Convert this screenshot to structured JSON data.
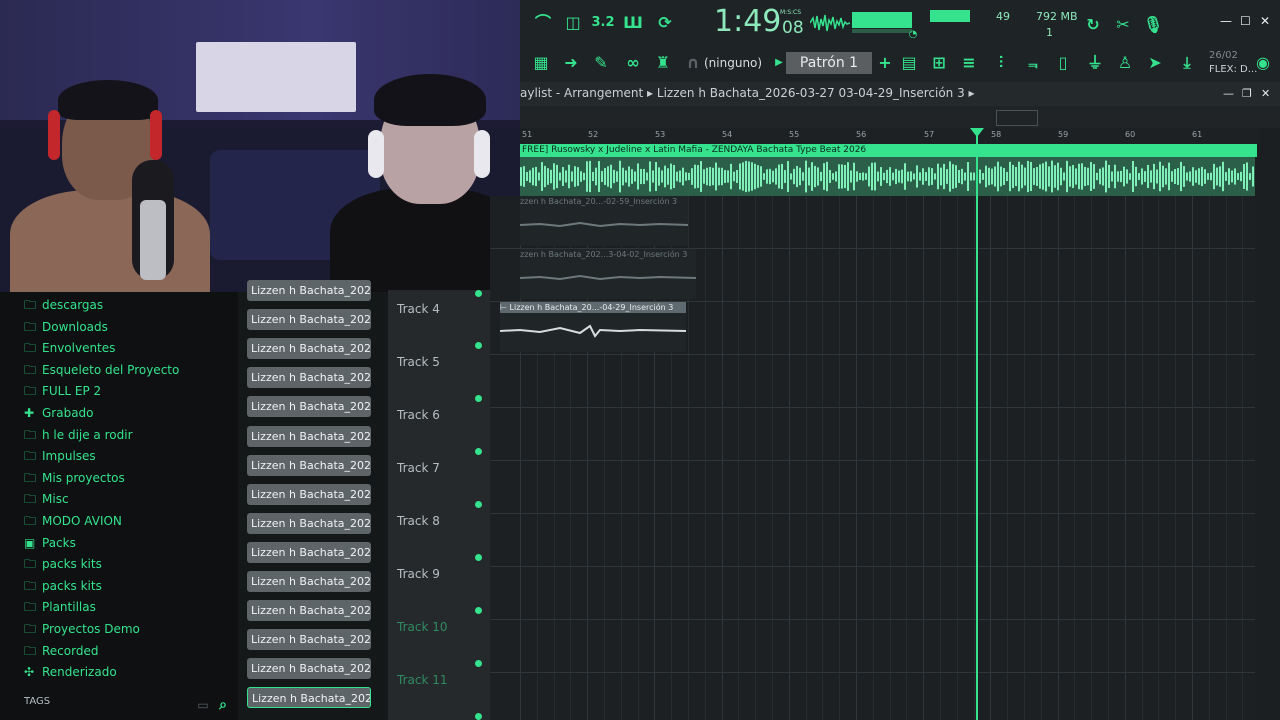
{
  "toolbar": {
    "clock": "1:49",
    "clock_sub": "08",
    "clock_label": "M:S:CS",
    "cpu": "49",
    "memory": "792 MB",
    "memory_sub": "1",
    "mode": "(ninguno)",
    "pattern": "Patrón 1",
    "date": "26/02",
    "flex": "FLEX: D...",
    "icons": [
      "pitch-icon",
      "metronome-icon",
      "step-icon",
      "wait-icon",
      "loop-icon",
      "tempo-knob-icon",
      "piano-icon",
      "arrow-right-icon",
      "brush-icon",
      "link-icon",
      "stamp-icon",
      "headphones-icon",
      "pattern-prev-icon",
      "pattern-add-icon",
      "playlist-icon",
      "channel-rack-icon",
      "mixer-icon",
      "browser-icon",
      "plugin-icon",
      "render-icon",
      "record-icon",
      "cut-icon",
      "mic-icon",
      "download-icon",
      "pop-icon"
    ]
  },
  "playlist": {
    "title": "aylist - Arrangement  ▸  Lizzen h Bachata_2026-03-27 03-04-29_Inserción 3  ▸",
    "ruler": [
      "51",
      "52",
      "53",
      "54",
      "55",
      "56",
      "57",
      "58",
      "59",
      "60",
      "61"
    ],
    "main_clip": "FREE] Rusowsky x Judeline x Latin Mafia - ZENDAYA  Bachata Type Beat 2026",
    "clips": [
      {
        "label": "zzen h Bachata_20...-02-59_Inserción 3"
      },
      {
        "label": "zzen h Bachata_202...3-04-02_Inserción 3"
      },
      {
        "label": "⊢ Lizzen h Bachata_20...-04-29_Inserción 3"
      }
    ],
    "tracks": [
      "Track 4",
      "Track 5",
      "Track 6",
      "Track 7",
      "Track 8",
      "Track 9",
      "Track 10",
      "Track 11"
    ]
  },
  "browser": {
    "folders": [
      {
        "icon": "folder-icon",
        "label": "descargas"
      },
      {
        "icon": "folder-icon",
        "label": "Downloads"
      },
      {
        "icon": "folder-icon",
        "label": "Envolventes"
      },
      {
        "icon": "folder-icon",
        "label": "Esqueleto del Proyecto"
      },
      {
        "icon": "folder-icon",
        "label": "FULL EP 2"
      },
      {
        "icon": "plus-icon",
        "label": "Grabado"
      },
      {
        "icon": "folder-icon",
        "label": "h le dije a rodir"
      },
      {
        "icon": "folder-icon",
        "label": "Impulses"
      },
      {
        "icon": "folder-icon",
        "label": "Mis proyectos"
      },
      {
        "icon": "folder-icon",
        "label": "Misc"
      },
      {
        "icon": "folder-icon",
        "label": "MODO AVION"
      },
      {
        "icon": "packs-icon",
        "label": "Packs"
      },
      {
        "icon": "folder-icon",
        "label": "packs kits"
      },
      {
        "icon": "folder-icon",
        "label": "packs kits"
      },
      {
        "icon": "folder-icon",
        "label": "Plantillas"
      },
      {
        "icon": "folder-icon",
        "label": "Proyectos Demo"
      },
      {
        "icon": "folder-icon",
        "label": "Recorded"
      },
      {
        "icon": "render-icon",
        "label": "Renderizado"
      }
    ],
    "tags": "TAGS"
  },
  "clip_list": {
    "items": [
      "Lizzen h Bachata_2026-0...",
      "Lizzen h Bachata_2026-0...",
      "Lizzen h Bachata_2026-0...",
      "Lizzen h Bachata_2026-0...",
      "Lizzen h Bachata_2026-0...",
      "Lizzen h Bachata_2026-0...",
      "Lizzen h Bachata_2026-0...",
      "Lizzen h Bachata_2026-0...",
      "Lizzen h Bachata_2026-0...",
      "Lizzen h Bachata_2026-0...",
      "Lizzen h Bachata_2026-0...",
      "Lizzen h Bachata_2026-0...",
      "Lizzen h Bachata_2026-0...",
      "Lizzen h Bachata_2026-0...",
      "Lizzen h Bachata_2026-0..."
    ]
  },
  "colors": {
    "accent": "#35e38e",
    "background": "#1b1f22"
  }
}
